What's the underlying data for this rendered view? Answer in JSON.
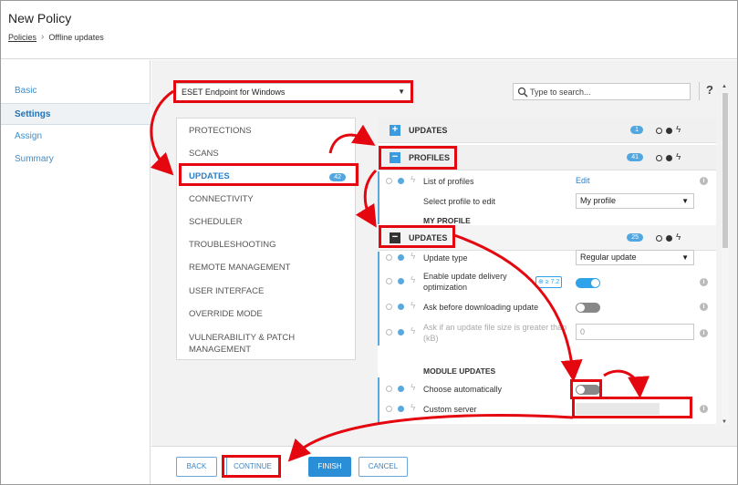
{
  "header": {
    "title": "New Policy",
    "breadcrumb": {
      "root": "Policies",
      "current": "Offline updates"
    }
  },
  "nav": {
    "items": [
      {
        "label": "Basic",
        "active": false
      },
      {
        "label": "Settings",
        "active": true
      },
      {
        "label": "Assign",
        "active": false
      },
      {
        "label": "Summary",
        "active": false
      }
    ]
  },
  "toolbar": {
    "product": "ESET Endpoint for Windows",
    "search_placeholder": "Type to search...",
    "help": "?"
  },
  "categories": {
    "items": [
      {
        "label": "PROTECTIONS"
      },
      {
        "label": "SCANS"
      },
      {
        "label": "UPDATES",
        "badge": "42",
        "active": true
      },
      {
        "label": "CONNECTIVITY"
      },
      {
        "label": "SCHEDULER"
      },
      {
        "label": "TROUBLESHOOTING"
      },
      {
        "label": "REMOTE MANAGEMENT"
      },
      {
        "label": "USER INTERFACE"
      },
      {
        "label": "OVERRIDE MODE"
      },
      {
        "label": "VULNERABILITY & PATCH MANAGEMENT"
      }
    ]
  },
  "panel": {
    "updates_section": {
      "label": "UPDATES",
      "badge": "1"
    },
    "profiles_section": {
      "label": "PROFILES",
      "badge": "41"
    },
    "list_of_profiles": {
      "label": "List of profiles",
      "action": "Edit"
    },
    "select_profile": {
      "label": "Select profile to edit",
      "value": "My profile"
    },
    "my_profile_title": "MY PROFILE",
    "profile_updates_section": {
      "label": "UPDATES",
      "badge": "25"
    },
    "update_type": {
      "label": "Update type",
      "value": "Regular update"
    },
    "delivery_opt": {
      "label_line1": "Enable update delivery",
      "label_line2": "optimization",
      "version": "≥ 7.2",
      "enabled": true
    },
    "ask_before": {
      "label": "Ask before downloading update",
      "enabled": false
    },
    "ask_size": {
      "label_line1": "Ask if an update file size is greater than",
      "label_line2": "(kB)",
      "value": "0"
    },
    "module_updates_title": "MODULE UPDATES",
    "choose_auto": {
      "label": "Choose automatically",
      "enabled": false
    },
    "custom_server": {
      "label": "Custom server",
      "value": ""
    }
  },
  "footer": {
    "back": "BACK",
    "continue": "CONTINUE",
    "finish": "FINISH",
    "cancel": "CANCEL"
  },
  "colors": {
    "highlight": "#e4070f",
    "accent": "#2a8fd7",
    "nav_link": "#3a8fd1"
  }
}
